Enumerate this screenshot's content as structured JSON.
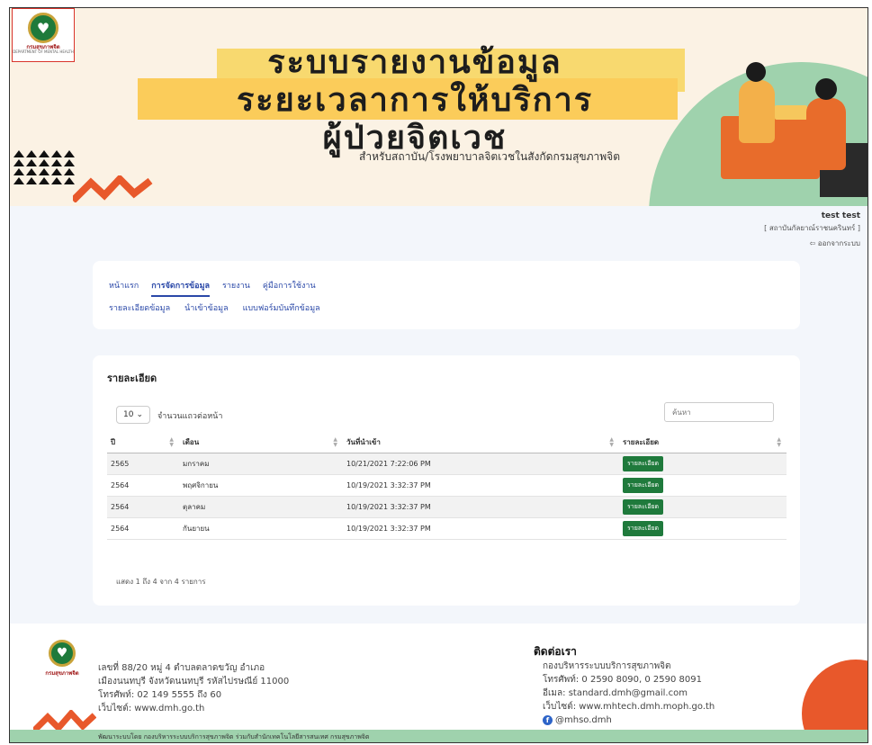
{
  "banner": {
    "logo_text": "กรมสุขภาพจิต",
    "logo_subtext": "DEPARTMENT OF MENTAL HEALTH",
    "title_line1": "ระบบรายงานข้อมูล",
    "title_line2": "ระยะเวลาการให้บริการ",
    "title_line3": "ผู้ป่วยจิตเวช",
    "subtitle": "สำหรับสถาบัน/โรงพยาบาลจิตเวชในสังกัดกรมสุขภาพจิต"
  },
  "user": {
    "name": "test test",
    "org": "[ สถาบันกัลยาณ์ราชนครินทร์ ]",
    "logout": "ออกจากระบบ"
  },
  "nav": {
    "tabs": [
      "หน้าแรก",
      "การจัดการข้อมูล",
      "รายงาน",
      "คู่มือการใช้งาน"
    ],
    "active_tab": "การจัดการข้อมูล",
    "subtabs": [
      "รายละเอียดข้อมูล",
      "นำเข้าข้อมูล",
      "แบบฟอร์มบันทึกข้อมูล"
    ]
  },
  "details": {
    "title": "รายละเอียด",
    "page_length": "10",
    "page_length_label": "จำนวนแถวต่อหน้า",
    "search_placeholder": "ค้นหา",
    "columns": [
      "ปี",
      "เดือน",
      "วันที่นำเข้า",
      "รายละเอียด"
    ],
    "rows": [
      {
        "year": "2565",
        "month": "มกราคม",
        "date": "10/21/2021 7:22:06 PM",
        "action": "รายละเอียด"
      },
      {
        "year": "2564",
        "month": "พฤศจิกายน",
        "date": "10/19/2021 3:32:37 PM",
        "action": "รายละเอียด"
      },
      {
        "year": "2564",
        "month": "ตุลาคม",
        "date": "10/19/2021 3:32:37 PM",
        "action": "รายละเอียด"
      },
      {
        "year": "2564",
        "month": "กันยายน",
        "date": "10/19/2021 3:32:37 PM",
        "action": "รายละเอียด"
      }
    ],
    "info": "แสดง 1 ถึง 4 จาก 4 รายการ"
  },
  "footer": {
    "logo_text": "กรมสุขภาพจิต",
    "address": [
      "เลขที่ 88/20 หมู่ 4 ตำบลตลาดขวัญ อำเภอ",
      "เมืองนนทบุรี จังหวัดนนทบุรี รหัสไปรษณีย์ 11000",
      "โทรศัพท์: 02 149 5555 ถึง 60",
      "เว็บไซต์: www.dmh.go.th"
    ],
    "contact_title": "ติดต่อเรา",
    "contact": [
      "กองบริหารระบบบริการสุขภาพจิต",
      "โทรศัพท์: 0 2590 8090, 0 2590 8091",
      "อีเมล: standard.dmh@gmail.com",
      "เว็บไซต์: www.mhtech.dmh.moph.go.th"
    ],
    "facebook": "@mhso.dmh",
    "bottom_bar": "พัฒนาระบบโดย กองบริหารระบบบริการสุขภาพจิต ร่วมกับสำนักเทคโนโลยีสารสนเทศ กรมสุขภาพจิต"
  },
  "colors": {
    "banner_bg": "#fbf2e4",
    "highlight": "#fbcc5a",
    "green": "#1f7a3c",
    "link_blue": "#2a48a8",
    "mint": "#9fd2ad",
    "orange": "#e8582b"
  }
}
